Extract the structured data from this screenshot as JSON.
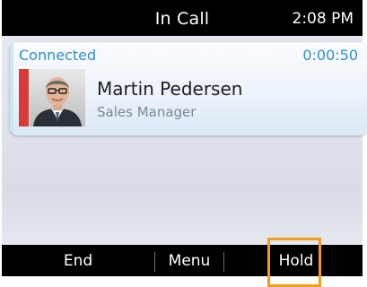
{
  "status_bar": {
    "title": "In Call",
    "time": "2:08 PM"
  },
  "call": {
    "state": "Connected",
    "timer": "0:00:50",
    "caller_name": "Martin Pedersen",
    "caller_title": "Sales Manager",
    "avatar_icon": "person-photo-icon"
  },
  "softkeys": {
    "end": "End",
    "menu": "Menu",
    "hold": "Hold"
  },
  "colors": {
    "accent_blue": "#2f8fc7",
    "caller_strip": "#d93a35",
    "highlight": "#f39a1f"
  }
}
